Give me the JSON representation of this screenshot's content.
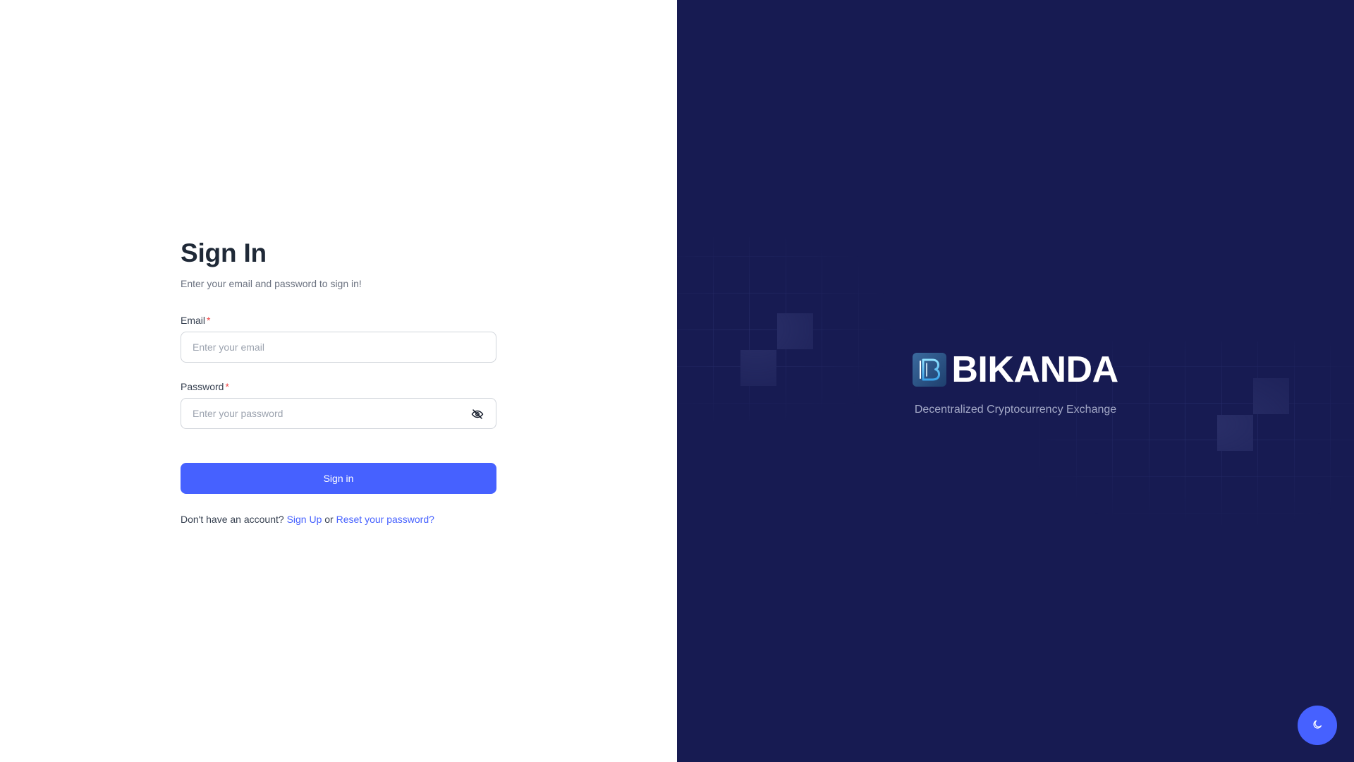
{
  "signin": {
    "title": "Sign In",
    "subtitle": "Enter your email and password to sign in!",
    "email": {
      "label": "Email",
      "required_mark": "*",
      "placeholder": "Enter your email",
      "value": ""
    },
    "password": {
      "label": "Password",
      "required_mark": "*",
      "placeholder": "Enter your password",
      "value": "",
      "toggle_icon": "eye-off-icon"
    },
    "submit_label": "Sign in",
    "footer": {
      "prompt": "Don't have an account?",
      "signup_link": "Sign Up",
      "separator": "or",
      "reset_link": "Reset your password?"
    }
  },
  "brand": {
    "logo_icon": "bikanda-logo-icon",
    "name": "BIKANDA",
    "tagline": "Decentralized Cryptocurrency Exchange"
  },
  "theme_toggle": {
    "icon": "moon-icon"
  },
  "colors": {
    "accent": "#4661ff",
    "brand_panel": "#171b52",
    "title_text": "#1f2937",
    "required": "#ef4444"
  }
}
